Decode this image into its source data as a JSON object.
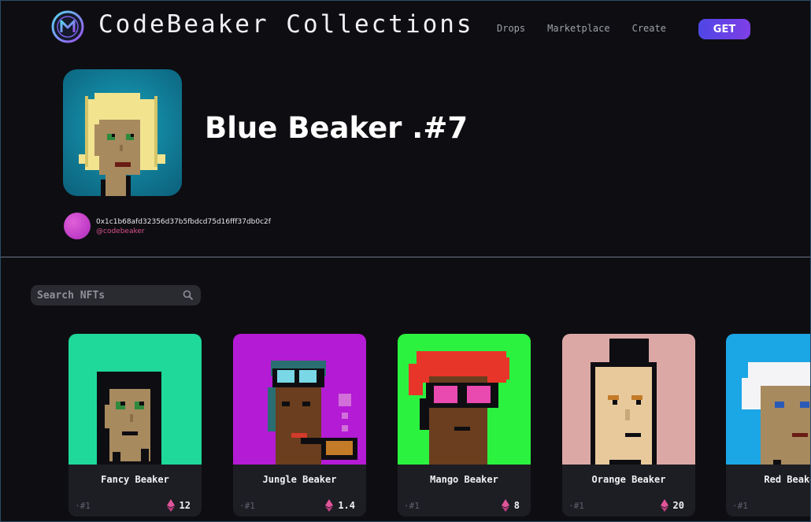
{
  "header": {
    "brand": "CodeBeaker Collections",
    "nav": [
      "Drops",
      "Marketplace",
      "Create"
    ],
    "get_label": "GET"
  },
  "hero": {
    "title": "Blue Beaker .#7",
    "owner_address": "0x1c1b68afd32356d37b5fbdcd75d16fff37db0c2f",
    "owner_handle": "@codebeaker",
    "avatar_bg": "#117c96"
  },
  "search": {
    "placeholder": "Search NFTs"
  },
  "cards": [
    {
      "name": "Fancy Beaker",
      "number": "#1",
      "price": "12",
      "bg": "#1ed99a"
    },
    {
      "name": "Jungle Beaker",
      "number": "#1",
      "price": "1.4",
      "bg": "#b41bd4"
    },
    {
      "name": "Mango Beaker",
      "number": "#1",
      "price": "8",
      "bg": "#2bf23f"
    },
    {
      "name": "Orange Beaker",
      "number": "#1",
      "price": "20",
      "bg": "#dca8a6"
    },
    {
      "name": "Red Beaker",
      "number": "#1",
      "price": "",
      "bg": "#1ba6e6"
    }
  ],
  "colors": {
    "accent": "#5d44e6",
    "eth": "#e0559a",
    "handle": "#d9508e"
  },
  "icons": {
    "logo": "codebeaker-logo-icon",
    "search": "search-icon",
    "currency": "eth-icon"
  }
}
